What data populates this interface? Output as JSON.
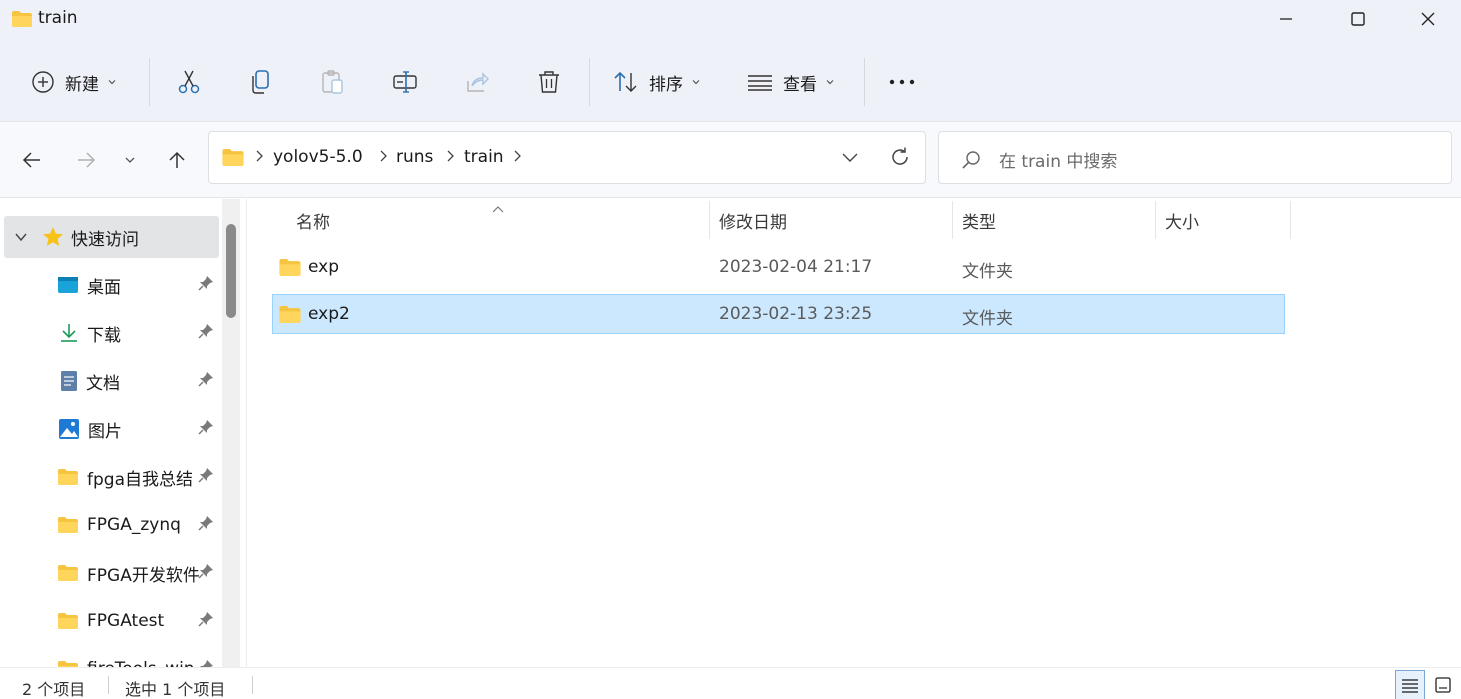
{
  "window": {
    "title": "train"
  },
  "toolbar": {
    "new_label": "新建",
    "sort_label": "排序",
    "view_label": "查看"
  },
  "address": {
    "crumbs": [
      "yolov5-5.0",
      "runs",
      "train"
    ]
  },
  "search": {
    "placeholder": "在 train 中搜索"
  },
  "sidebar": {
    "quick_access": "快速访问",
    "items": [
      {
        "label": "桌面",
        "icon": "desktop-icon"
      },
      {
        "label": "下载",
        "icon": "download-icon"
      },
      {
        "label": "文档",
        "icon": "document-icon"
      },
      {
        "label": "图片",
        "icon": "pictures-icon"
      },
      {
        "label": "fpga自我总结",
        "icon": "folder-icon"
      },
      {
        "label": "FPGA_zynq",
        "icon": "folder-icon"
      },
      {
        "label": "FPGA开发软件",
        "icon": "folder-icon"
      },
      {
        "label": "FPGAtest",
        "icon": "folder-icon"
      },
      {
        "label": "fireTools_win",
        "icon": "folder-icon"
      }
    ]
  },
  "columns": {
    "name": "名称",
    "modified": "修改日期",
    "type": "类型",
    "size": "大小"
  },
  "files": [
    {
      "name": "exp",
      "modified": "2023-02-04 21:17",
      "type": "文件夹",
      "size": "",
      "selected": false
    },
    {
      "name": "exp2",
      "modified": "2023-02-13 23:25",
      "type": "文件夹",
      "size": "",
      "selected": true
    }
  ],
  "status": {
    "count": "2 个项目",
    "selection": "选中 1 个项目"
  },
  "colors": {
    "folder": "#f5c542",
    "selection": "#cce8ff",
    "selection_border": "#99d1ff",
    "chrome": "#eef2f8"
  }
}
